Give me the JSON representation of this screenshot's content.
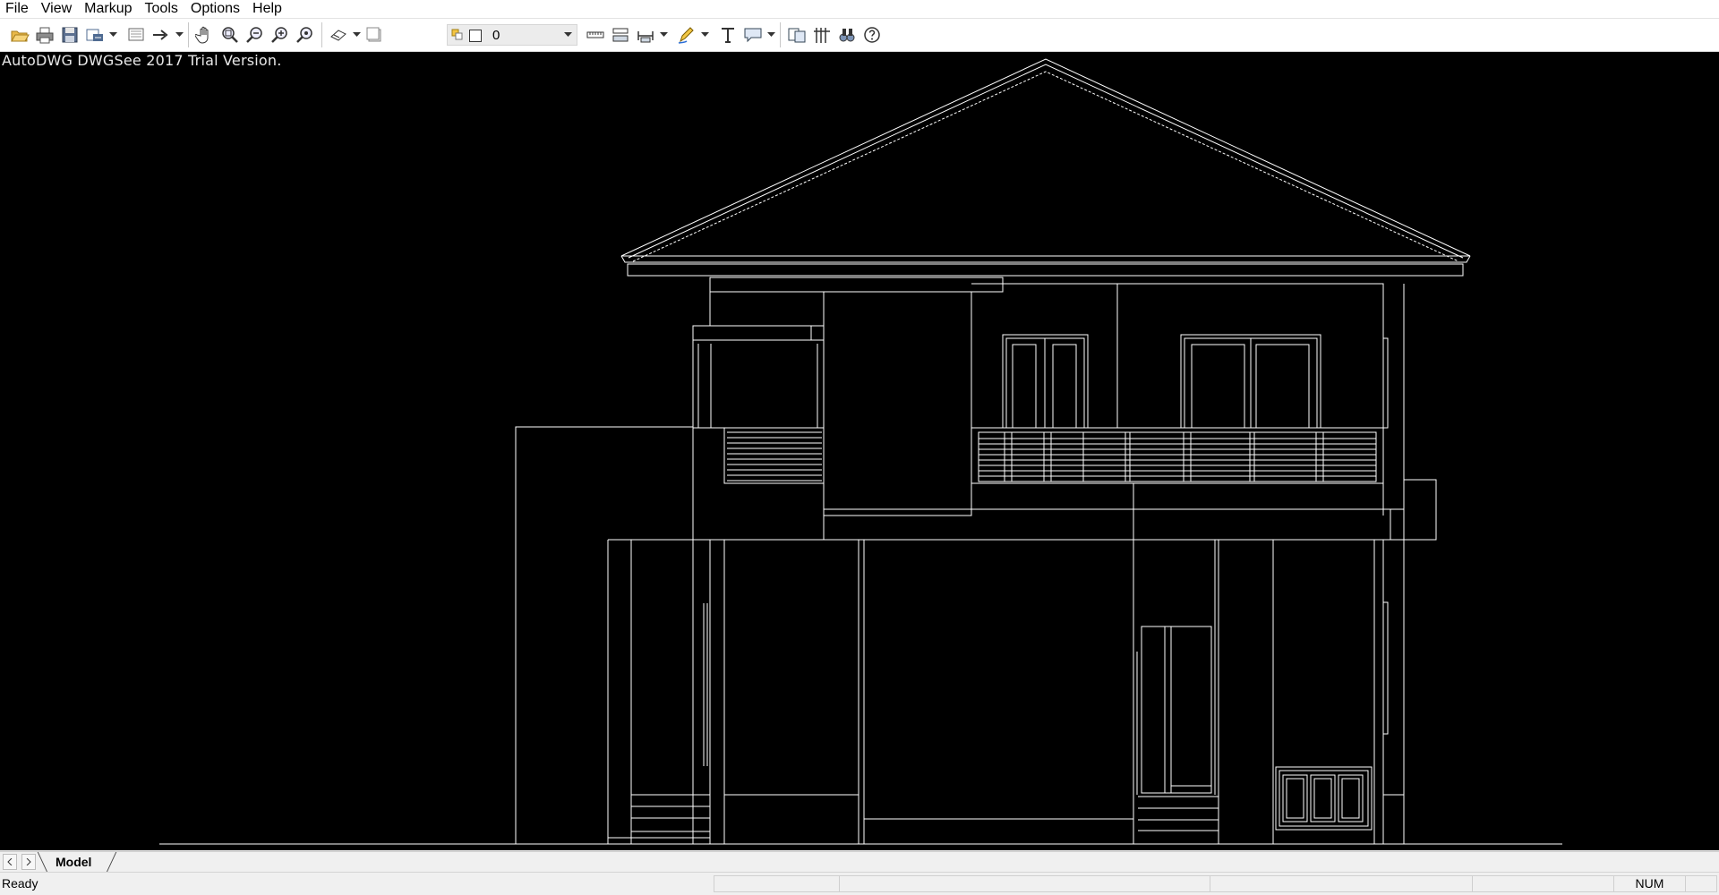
{
  "menu": [
    "File",
    "View",
    "Markup",
    "Tools",
    "Options",
    "Help"
  ],
  "toolbar": {
    "layer_value": "0",
    "icons": [
      "open-icon",
      "print-icon",
      "save-icon",
      "export-icon",
      "page-setup-icon",
      "arrow-icon",
      "pan-hand-icon",
      "zoom-window-icon",
      "zoom-out-icon",
      "zoom-in-icon",
      "zoom-extents-icon",
      "layers-icon",
      "layer-state-icon",
      "distance-icon",
      "dimension-icon",
      "measure-icon",
      "pen-icon",
      "text-icon",
      "callout-icon",
      "compare-icon",
      "hatch-icon",
      "find-icon",
      "help-icon"
    ]
  },
  "canvas": {
    "watermark": "AutoDWG DWGSee 2017 Trial Version.",
    "background": "#000000",
    "stroke": "#ffffff"
  },
  "tabs": {
    "active": "Model"
  },
  "status": {
    "text": "Ready",
    "num": "NUM"
  }
}
